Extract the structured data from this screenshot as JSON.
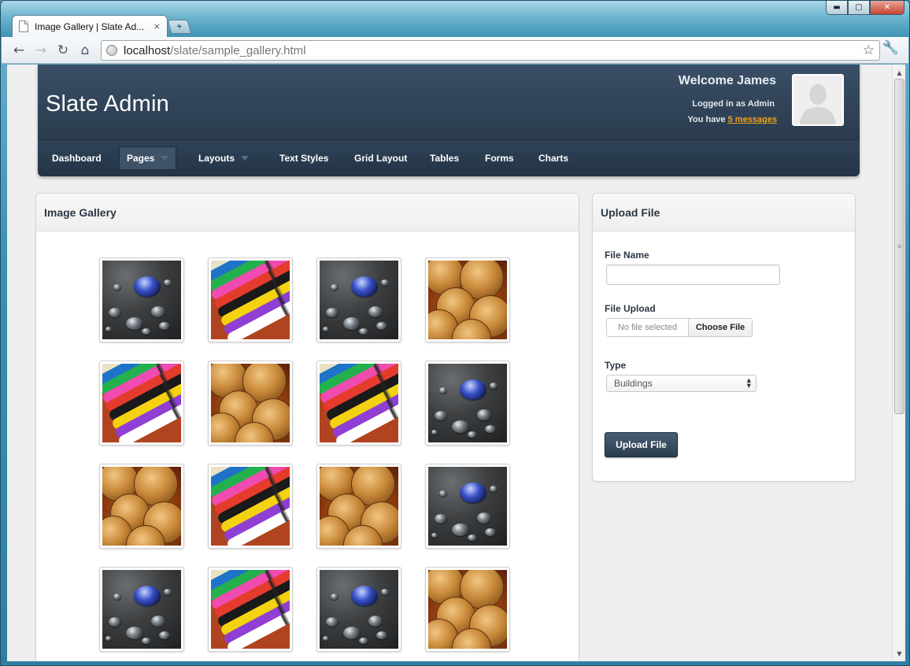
{
  "browser": {
    "tab_title": "Image Gallery | Slate Ad...",
    "tab_close": "×",
    "new_tab": "+",
    "url_host": "localhost",
    "url_path": "/slate/sample_gallery.html",
    "window_controls": {
      "minimize": "▬",
      "maximize": "▢",
      "close": "✕"
    },
    "nav_glyphs": {
      "back": "←",
      "forward": "→",
      "reload": "↻",
      "home": "⌂",
      "star": "☆",
      "wrench": "🔧"
    },
    "scroll": {
      "up": "▲",
      "down": "▼",
      "grip": "≡"
    }
  },
  "site": {
    "title": "Slate Admin",
    "welcome": "Welcome James",
    "logged_in": "Logged in as Admin",
    "messages_prefix": "You have ",
    "messages_link": "5 messages"
  },
  "nav": {
    "items": [
      {
        "label": "Dashboard",
        "active": false,
        "dropdown": false
      },
      {
        "label": "Pages",
        "active": true,
        "dropdown": true
      },
      {
        "label": "Layouts",
        "active": false,
        "dropdown": true
      },
      {
        "label": "Text Styles",
        "active": false,
        "dropdown": false
      },
      {
        "label": "Grid Layout",
        "active": false,
        "dropdown": false
      },
      {
        "label": "Tables",
        "active": false,
        "dropdown": false
      },
      {
        "label": "Forms",
        "active": false,
        "dropdown": false
      },
      {
        "label": "Charts",
        "active": false,
        "dropdown": false
      }
    ]
  },
  "gallery": {
    "title": "Image Gallery",
    "images": [
      [
        "water",
        "crayons",
        "water",
        "coins"
      ],
      [
        "crayons",
        "coins",
        "crayons",
        "water"
      ],
      [
        "coins",
        "crayons",
        "coins",
        "water"
      ],
      [
        "water",
        "crayons",
        "water",
        "coins"
      ]
    ]
  },
  "upload": {
    "title": "Upload File",
    "file_name_label": "File Name",
    "file_name_value": "",
    "file_upload_label": "File Upload",
    "no_file_text": "No file selected",
    "choose_file_label": "Choose File",
    "type_label": "Type",
    "type_selected": "Buildings",
    "submit_label": "Upload File"
  },
  "colors": {
    "header_bg": "#2c3d50",
    "accent_link": "#f0a21c",
    "page_bg": "#efefef"
  }
}
